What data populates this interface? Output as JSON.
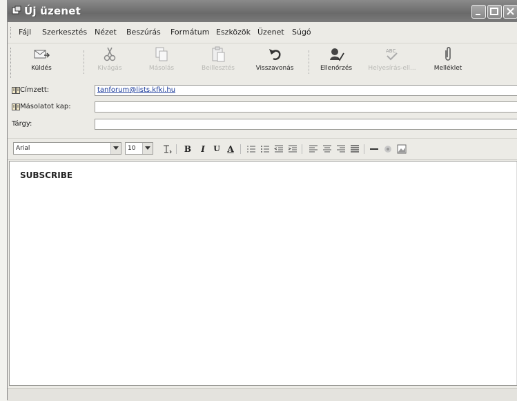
{
  "window": {
    "title": "Új üzenet"
  },
  "menu": {
    "items": [
      "Fájl",
      "Szerkesztés",
      "Nézet",
      "Beszúrás",
      "Formátum",
      "Eszközök",
      "Üzenet",
      "Súgó"
    ]
  },
  "toolbar": {
    "send": "Küldés",
    "cut": "Kivágás",
    "copy": "Másolás",
    "paste": "Beillesztés",
    "undo": "Visszavonás",
    "check": "Ellenőrzés",
    "spelling": "Helyesírás-ell...",
    "attach": "Melléklet"
  },
  "fields": {
    "to_label": "Címzett:",
    "to_value": "tanforum@lists.kfki.hu",
    "cc_label": "Másolatot kap:",
    "cc_value": "",
    "subject_label": "Tárgy:",
    "subject_value": ""
  },
  "format": {
    "font": "Arial",
    "size": "10",
    "bold": "B",
    "italic": "I",
    "underline": "U",
    "fontcolor": "A"
  },
  "message": {
    "body": "SUBSCRIBE"
  }
}
